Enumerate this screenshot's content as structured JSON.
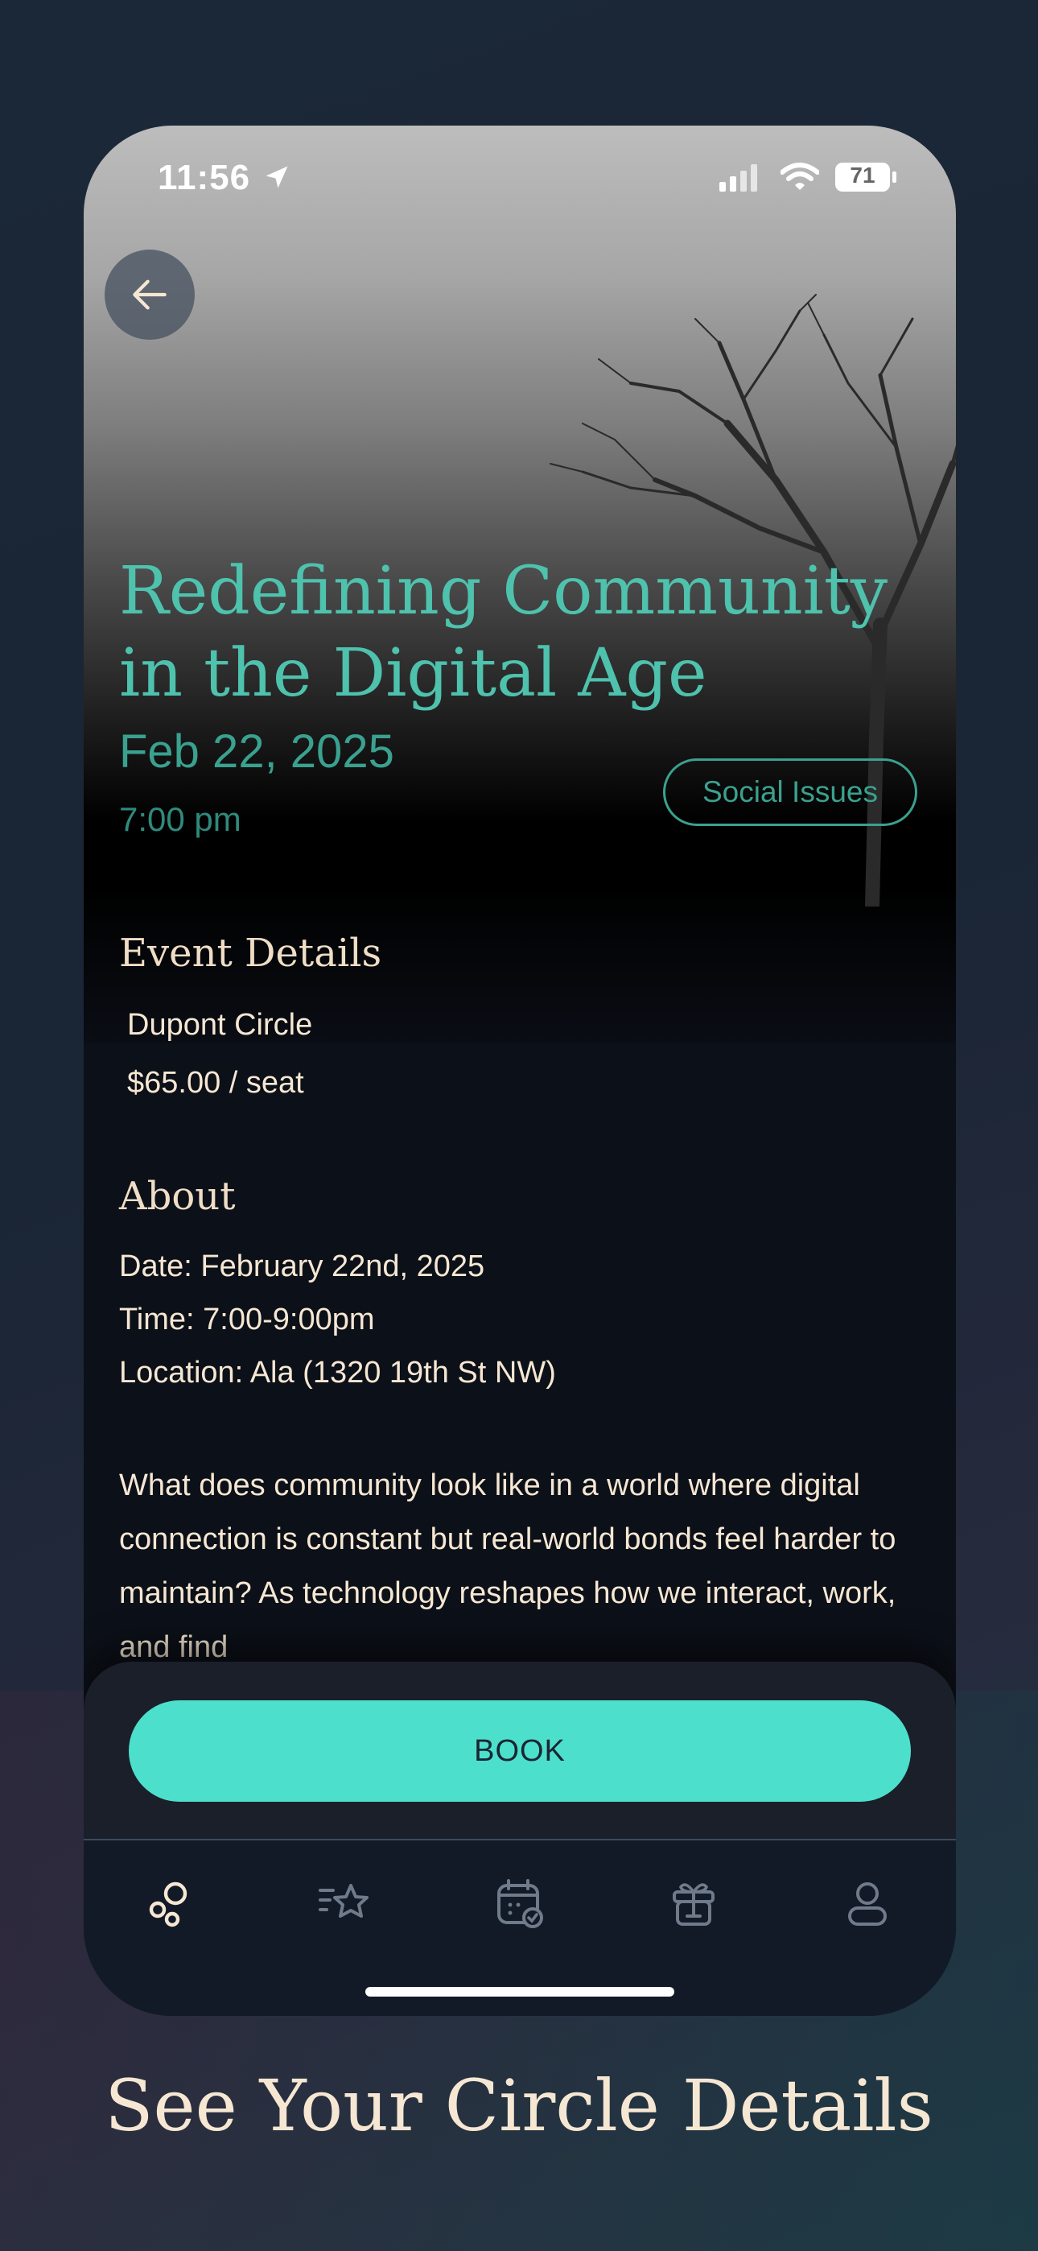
{
  "status_bar": {
    "time": "11:56",
    "battery": "71"
  },
  "event": {
    "title": "Redefining Community in the Digital Age",
    "date": "Feb 22, 2025",
    "time": "7:00 pm",
    "category": "Social Issues"
  },
  "details": {
    "heading": "Event Details",
    "location": "Dupont Circle",
    "price": "$65.00 / seat"
  },
  "about": {
    "heading": "About",
    "lines": [
      "Date: February 22nd, 2025",
      "Time: 7:00-9:00pm",
      "Location: Ala (1320 19th St NW)"
    ],
    "paragraph": "What does community look like in a world where digital connection is constant but real-world bonds feel harder to maintain? As technology reshapes how we interact, work, and find"
  },
  "actions": {
    "book_label": "BOOK"
  },
  "nav": {
    "items": [
      "circles-icon",
      "favorites-icon",
      "calendar-icon",
      "gift-icon",
      "profile-icon"
    ],
    "active_index": 0
  },
  "caption": "See Your Circle Details",
  "colors": {
    "accent": "#4ec2ad",
    "button": "#4ce0cc",
    "cream_text": "#f6e7d3",
    "background": "#1b2838"
  }
}
